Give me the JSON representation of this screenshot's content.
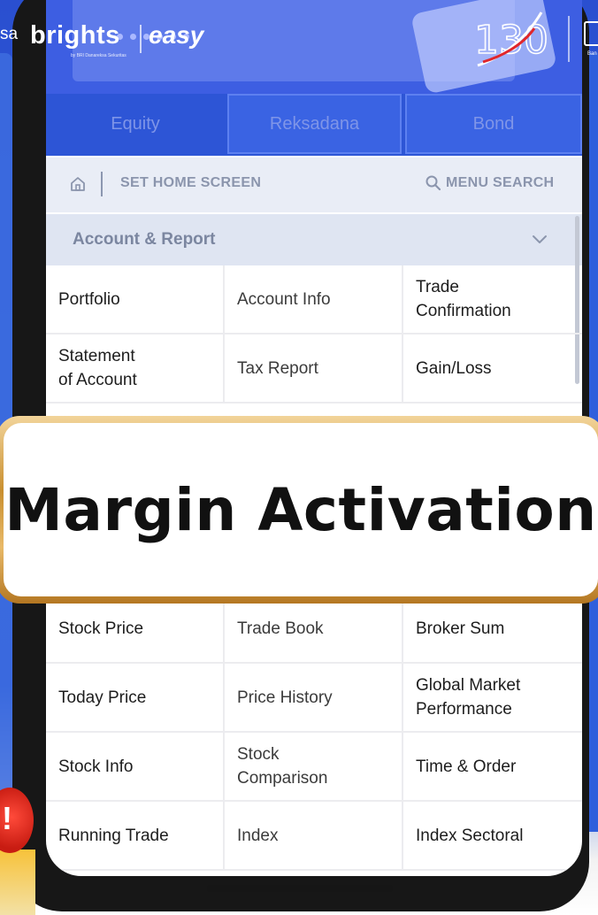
{
  "brand": {
    "left_cut": "sa",
    "name": "brights",
    "tagline": "by BRI Danareksa Sekuritas",
    "partner": "easy",
    "anniversary": "130",
    "right_cut": "Ban"
  },
  "tabs": [
    {
      "label": "Equity"
    },
    {
      "label": "Reksadana"
    },
    {
      "label": "Bond"
    }
  ],
  "toolbar": {
    "home_label": "SET HOME SCREEN",
    "search_label": "MENU SEARCH"
  },
  "section": {
    "title": "Account & Report"
  },
  "menu_top": [
    [
      "Portfolio",
      "Account Info",
      "Trade\nConfirmation"
    ],
    [
      "Statement\nof Account",
      "Tax Report",
      "Gain/Loss"
    ]
  ],
  "overlay": {
    "text": "Margin Activation"
  },
  "menu_bottom": [
    [
      "Stock Price",
      "Trade Book",
      "Broker Sum"
    ],
    [
      "Today Price",
      "Price History",
      "Global Market\nPerformance"
    ],
    [
      "Stock Info",
      "Stock\nComparison",
      "Time & Order"
    ],
    [
      "Running Trade",
      "Index",
      "Index Sectoral"
    ]
  ],
  "colors": {
    "brand_blue": "#2b56d4",
    "highlight_gold": "#c98f2f",
    "alert_red": "#d9261c"
  },
  "icons": [
    "home-icon",
    "search-icon",
    "chevron-down-icon",
    "alert-icon"
  ]
}
